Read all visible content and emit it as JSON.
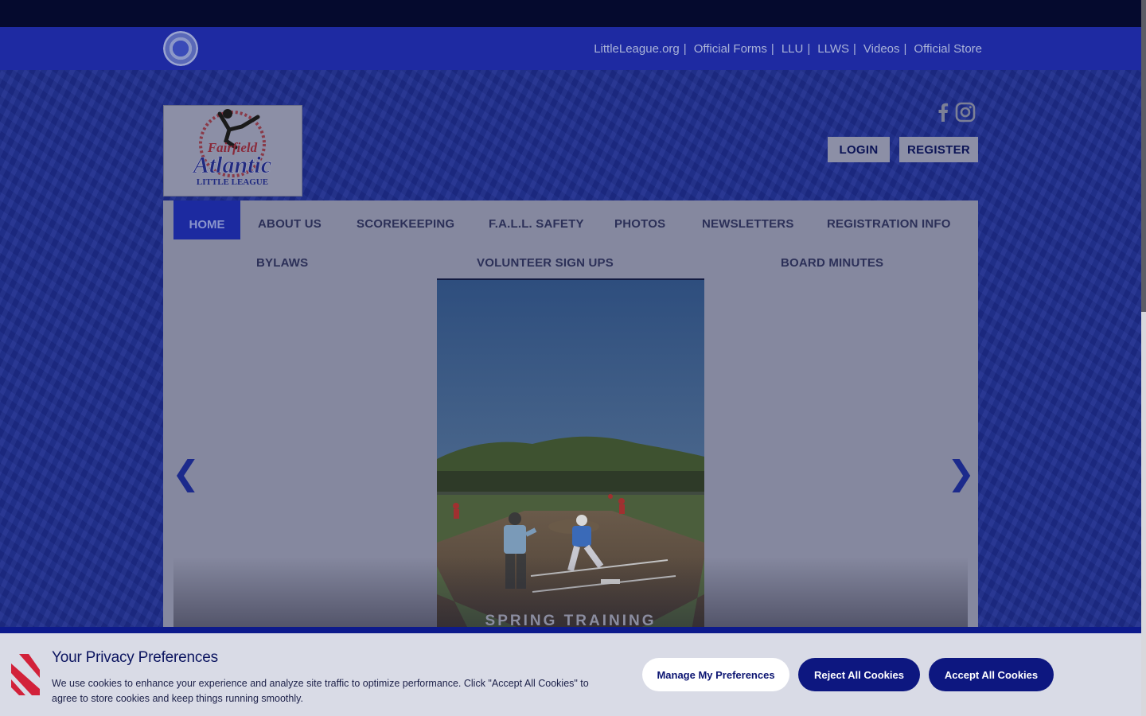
{
  "utility_nav": {
    "links": [
      "LittleLeague.org",
      "Official Forms",
      "LLU",
      "LLWS",
      "Videos",
      "Official Store"
    ],
    "separator": "|"
  },
  "header": {
    "logo_lines": [
      "Fairfield",
      "Atlantic",
      "LITTLE LEAGUE"
    ],
    "login_label": "LOGIN",
    "register_label": "REGISTER",
    "social_icons": [
      "facebook-icon",
      "instagram-icon"
    ]
  },
  "main_nav": {
    "row1": [
      "HOME",
      "ABOUT US",
      "SCOREKEEPING",
      "F.A.L.L. SAFETY",
      "PHOTOS",
      "NEWSLETTERS",
      "REGISTRATION INFO"
    ],
    "row2": [
      "BYLAWS",
      "VOLUNTEER SIGN UPS",
      "BOARD MINUTES"
    ],
    "active": "HOME"
  },
  "slideshow": {
    "caption": "SPRING TRAINING",
    "prev_glyph": "❮",
    "next_glyph": "❯"
  },
  "cookie_banner": {
    "title": "Your Privacy Preferences",
    "text": "We use cookies to enhance your experience and analyze site traffic to optimize performance. Click \"Accept All Cookies\" to agree to store cookies and keep things running smoothly.",
    "manage_label": "Manage My Preferences",
    "reject_label": "Reject All Cookies",
    "accept_label": "Accept All Cookies"
  },
  "colors": {
    "brand_navy": "#0d1780",
    "util_bar": "#1e2aa2",
    "accent_red": "#d2213a"
  }
}
